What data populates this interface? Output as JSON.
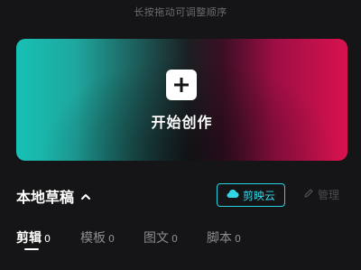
{
  "hint": "长按拖动可调整顺序",
  "hero": {
    "label": "开始创作",
    "icon": "plus-icon",
    "gradient_colors": [
      "#17c0b5",
      "#1b1f22",
      "#d8124f"
    ]
  },
  "drafts": {
    "title": "本地草稿",
    "title_icon": "chevron-up-icon",
    "cloud_button": {
      "label": "剪映云",
      "icon": "cloud-icon",
      "color": "#34d6e6"
    },
    "manage": {
      "label": "管理",
      "icon": "pencil-icon"
    }
  },
  "tabs": [
    {
      "label": "剪辑",
      "count": "0",
      "active": true
    },
    {
      "label": "模板",
      "count": "0",
      "active": false
    },
    {
      "label": "图文",
      "count": "0",
      "active": false
    },
    {
      "label": "脚本",
      "count": "0",
      "active": false
    }
  ]
}
